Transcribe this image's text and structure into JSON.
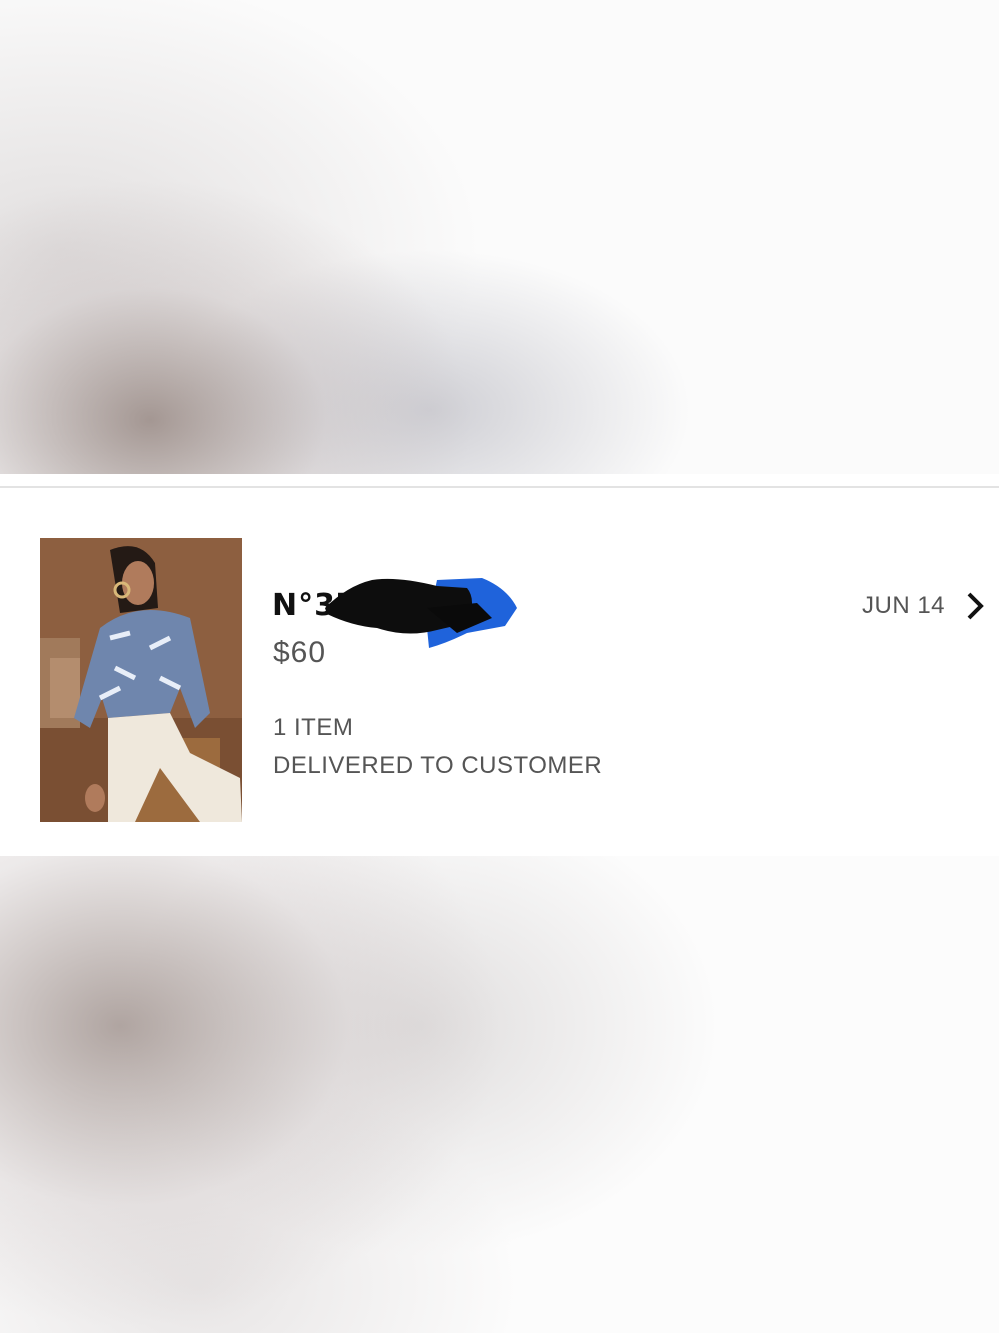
{
  "orders": [
    {
      "number": "N°37205",
      "price": "$60",
      "item_count": "1 ITEM",
      "status": "DELIVERED TO CUSTOMER",
      "date": "JUN 14",
      "thumbnail_icon": "product-photo-blouse",
      "chevron_icon": "chevron-right-icon"
    }
  ],
  "colors": {
    "text_primary": "#111111",
    "text_secondary": "#555555",
    "divider": "#e3e3e3"
  }
}
